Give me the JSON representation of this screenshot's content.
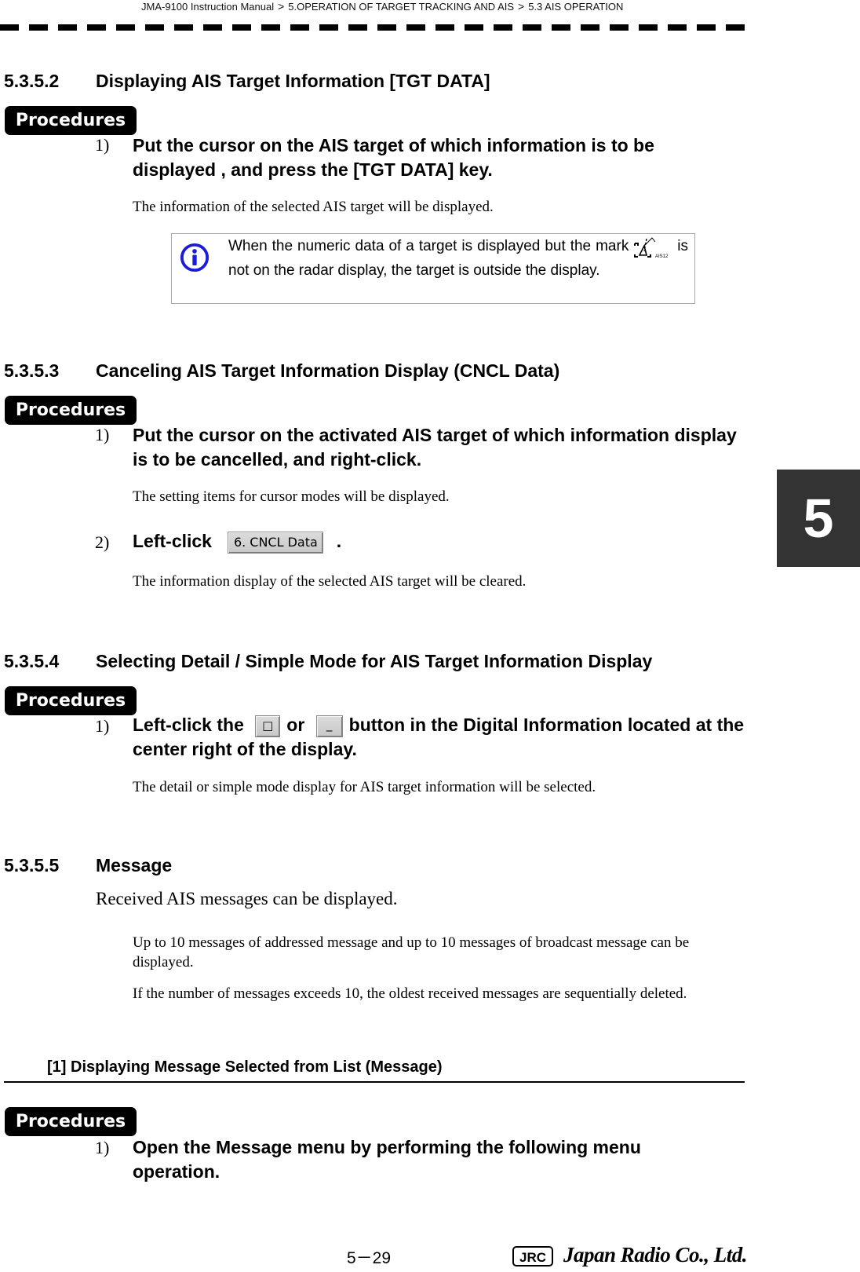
{
  "header": {
    "breadcrumb": [
      "JMA-9100 Instruction Manual",
      "5.OPERATION OF TARGET TRACKING AND AIS",
      "5.3  AIS OPERATION"
    ],
    "separator": ">"
  },
  "chapter_tab": "5",
  "sections": [
    {
      "number": "5.3.5.2",
      "title": "Displaying AIS Target Information [TGT DATA]",
      "procedures_label": "Procedures",
      "steps": [
        {
          "num": "1)",
          "text": "Put the cursor on the AIS target of which information is to be displayed , and press the [TGT DATA] key.",
          "result": "The information of the selected AIS target will be displayed."
        }
      ],
      "note": {
        "icon": "info-icon",
        "text_before": "When the numeric data of a target is displayed but the mark",
        "mark_icon": "ais-target-mark-icon",
        "mark_label": "AIS12",
        "text_after": "is not on the radar display, the target is outside the display."
      }
    },
    {
      "number": "5.3.5.3",
      "title": "Canceling AIS Target Information Display (CNCL Data)",
      "procedures_label": "Procedures",
      "steps": [
        {
          "num": "1)",
          "text": "Put the cursor on the activated AIS target of which information display is to be cancelled, and right-click.",
          "result": "The setting items for cursor modes will be displayed."
        },
        {
          "num": "2)",
          "text": "Left-click",
          "button": "6. CNCL Data",
          "suffix": ".",
          "result": "The information display of the selected AIS target will be cleared."
        }
      ]
    },
    {
      "number": "5.3.5.4",
      "title": "Selecting Detail / Simple Mode for AIS Target Information Display",
      "procedures_label": "Procedures",
      "steps": [
        {
          "num": "1)",
          "text_before": "Left-click the",
          "button_detail": "□",
          "text_mid": "or",
          "button_simple": "_",
          "text_after": "button in the Digital Information located at the center right of the display.",
          "result": "The detail or simple mode display for AIS target information will be selected."
        }
      ]
    },
    {
      "number": "5.3.5.5",
      "title": "Message",
      "intro": "Received AIS messages can be displayed.",
      "paragraphs": [
        "Up to 10 messages of addressed message and up to 10 messages of broadcast message can be displayed.",
        "If the number of messages exceeds 10, the oldest received messages are sequentially deleted."
      ],
      "subsection": {
        "title": "[1]  Displaying Message Selected from List (Message)",
        "procedures_label": "Procedures",
        "steps": [
          {
            "num": "1)",
            "text": "Open the Message menu by performing the following menu operation."
          }
        ]
      }
    }
  ],
  "footer": {
    "page": "5－29",
    "logo": "JRC",
    "company": "Japan Radio Co., Ltd."
  },
  "colors": {
    "info_icon": "#1a1adc",
    "chapter_tab_bg": "#333333",
    "badge_bg": "#000000"
  }
}
